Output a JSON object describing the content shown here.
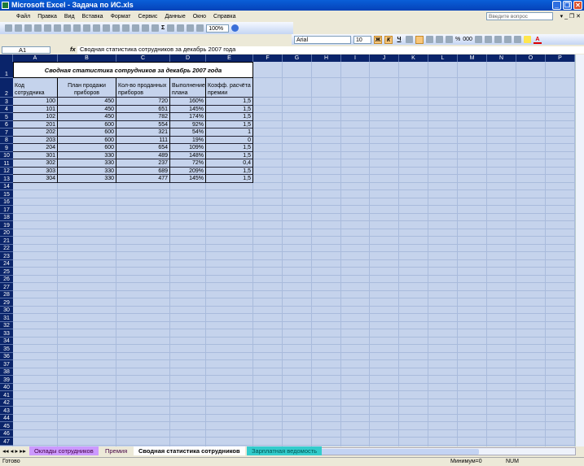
{
  "window": {
    "title": "Microsoft Excel - Задача по ИС.xls"
  },
  "menu": [
    "Файл",
    "Правка",
    "Вид",
    "Вставка",
    "Формат",
    "Сервис",
    "Данные",
    "Окно",
    "Справка"
  ],
  "help_placeholder": "Введите вопрос",
  "toolbar": {
    "zoom": "100%",
    "sum": "Σ"
  },
  "format": {
    "font": "Arial",
    "size": "10",
    "bold": "Ж",
    "italic": "К",
    "underline": "Ч",
    "percent": "%",
    "thousands": "000"
  },
  "formula_bar": {
    "name_box": "A1",
    "fx": "fx",
    "content": "Сводная статистика сотрудников за декабрь 2007 года"
  },
  "columns": [
    "A",
    "B",
    "C",
    "D",
    "E",
    "F",
    "G",
    "H",
    "I",
    "J",
    "K",
    "L",
    "M",
    "N",
    "O",
    "P"
  ],
  "table": {
    "title": "Сводная статистика сотрудников за декабрь 2007 года",
    "headers": [
      "Код сотрудника",
      "План продажи приборов",
      "Кол-во проданных приборов",
      "Выполнение плана",
      "Коэфф. расчёта премии"
    ],
    "rows": [
      [
        "100",
        "450",
        "720",
        "160%",
        "1,5"
      ],
      [
        "101",
        "450",
        "651",
        "145%",
        "1,5"
      ],
      [
        "102",
        "450",
        "782",
        "174%",
        "1,5"
      ],
      [
        "201",
        "600",
        "554",
        "92%",
        "1,5"
      ],
      [
        "202",
        "600",
        "321",
        "54%",
        "1"
      ],
      [
        "203",
        "600",
        "111",
        "19%",
        "0"
      ],
      [
        "204",
        "600",
        "654",
        "109%",
        "1,5"
      ],
      [
        "301",
        "330",
        "489",
        "148%",
        "1,5"
      ],
      [
        "302",
        "330",
        "237",
        "72%",
        "0,4"
      ],
      [
        "303",
        "330",
        "689",
        "209%",
        "1,5"
      ],
      [
        "304",
        "330",
        "477",
        "145%",
        "1,5"
      ]
    ]
  },
  "sheets": [
    {
      "name": "Оклады сотрудников",
      "color": "#cc99ff",
      "active": false
    },
    {
      "name": "Премия",
      "color": "#ece9d8",
      "active": false
    },
    {
      "name": "Сводная статистика сотрудников",
      "color": "#ffffff",
      "active": true
    },
    {
      "name": "Зарплатная ведомость",
      "color": "#33cccc",
      "active": false
    }
  ],
  "status": {
    "ready": "Готово",
    "minimum": "Минимум=0",
    "num": "NUM"
  }
}
